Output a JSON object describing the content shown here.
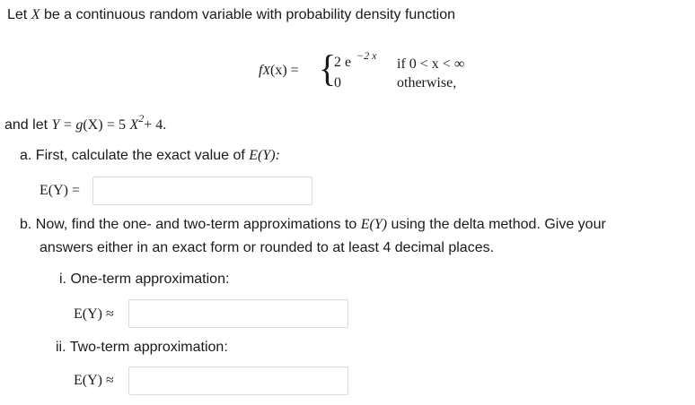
{
  "intro": {
    "lead": "Let",
    "var_X": "X",
    "rest": "be a continuous random variable with probability density function"
  },
  "pdf": {
    "lhs_f": "f",
    "lhs_X": "X",
    "lhs_paren": "(x)",
    "equals": "=",
    "case1_coef": "2 e",
    "case1_exp": "−2 x",
    "case1_cond": "if 0 < x < ∞",
    "case2_value": "0",
    "case2_cond": "otherwise,"
  },
  "transform": {
    "lead": "and let",
    "Y": "Y",
    "eq1": "=",
    "g": "g",
    "arg": "(X)",
    "eq2": "= 5",
    "X": "X",
    "exp": "2",
    "tail": "+ 4."
  },
  "part_a": {
    "prompt": "a. First, calculate the exact value of",
    "expr": "E(Y):",
    "answer_label": "E(Y) =",
    "answer_value": ""
  },
  "part_b": {
    "line1": "b. Now, find the one- and two-term approximations to",
    "expr": "E(Y)",
    "line1_tail": "using the delta method. Give your",
    "line2": "answers either in an exact form or rounded to at least 4 decimal places.",
    "sub_i": {
      "label": "i. One-term approximation:",
      "answer_label": "E(Y) ≈",
      "answer_value": ""
    },
    "sub_ii": {
      "label": "ii. Two-term approximation:",
      "answer_label": "E(Y) ≈",
      "answer_value": ""
    }
  }
}
